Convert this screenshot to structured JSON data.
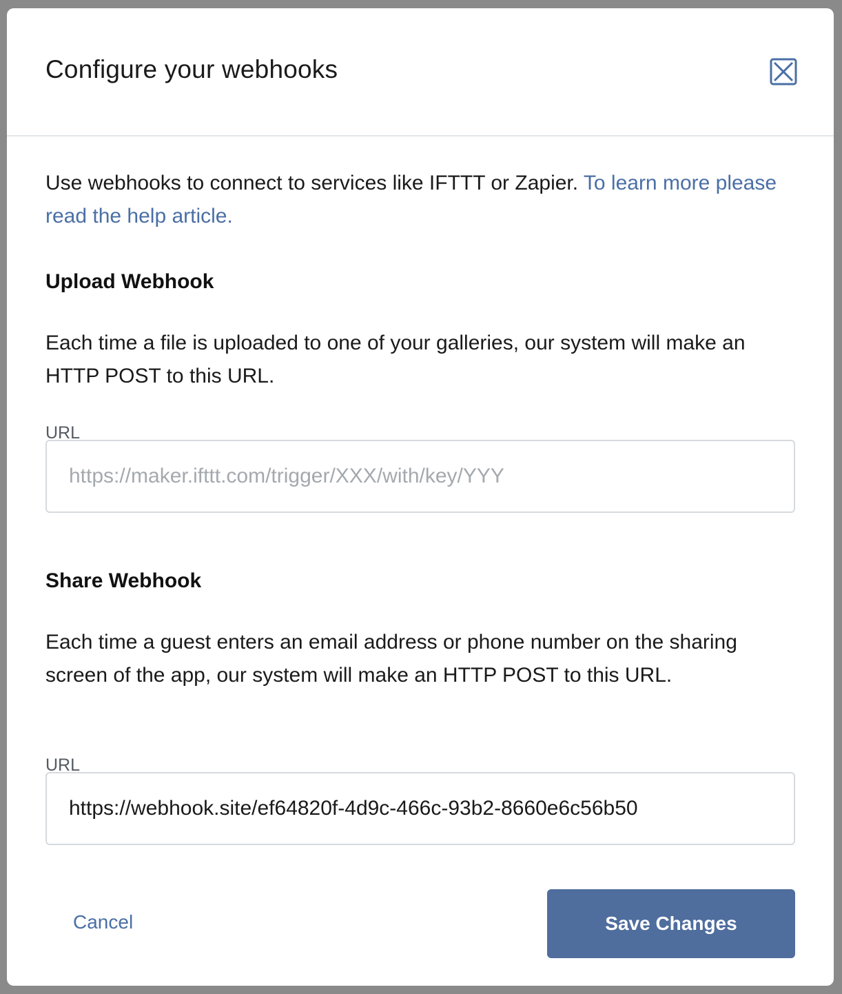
{
  "modal": {
    "title": "Configure your webhooks"
  },
  "intro": {
    "text": "Use webhooks to connect to services like IFTTT or Zapier. ",
    "link": "To learn more please read the help article."
  },
  "upload_webhook": {
    "title": "Upload Webhook",
    "description": "Each time a file is uploaded to one of your galleries, our system will make an HTTP POST to this URL.",
    "url_label": "URL",
    "url_placeholder": "https://maker.ifttt.com/trigger/XXX/with/key/YYY",
    "url_value": ""
  },
  "share_webhook": {
    "title": "Share Webhook",
    "description": "Each time a guest enters an email address or phone number on the sharing screen of the app, our system will make an HTTP POST to this URL.",
    "url_label": "URL",
    "url_placeholder": "",
    "url_value": "https://webhook.site/ef64820f-4d9c-466c-93b2-8660e6c56b50"
  },
  "footer": {
    "cancel_label": "Cancel",
    "save_label": "Save Changes"
  },
  "colors": {
    "accent": "#4f6d9d",
    "link": "#4a6fa5"
  },
  "icons": {
    "close": "close-x-box-icon"
  }
}
